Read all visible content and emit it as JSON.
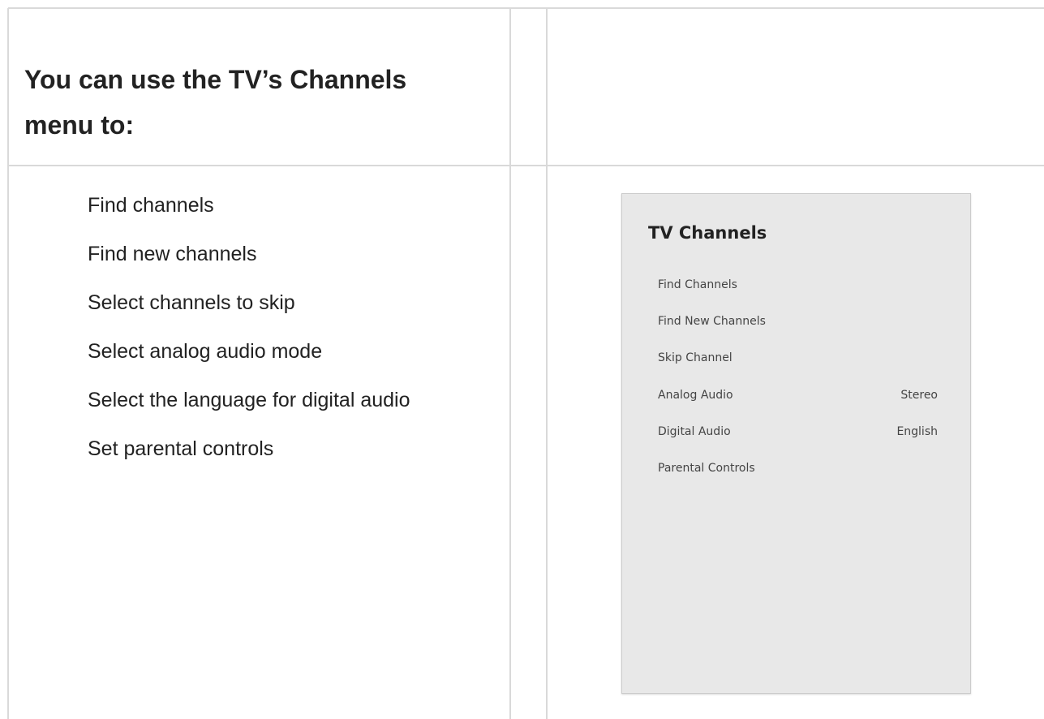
{
  "heading": "You can use the TV’s Channels menu to:",
  "features": [
    "Find channels",
    "Find new channels",
    "Select channels to skip",
    "Select analog audio mode",
    "Select the language for digital audio",
    "Set parental controls"
  ],
  "tv_menu": {
    "title": "TV Channels",
    "items": [
      {
        "label": "Find Channels",
        "value": ""
      },
      {
        "label": "Find New Channels",
        "value": ""
      },
      {
        "label": "Skip Channel",
        "value": ""
      },
      {
        "label": "Analog Audio",
        "value": "Stereo"
      },
      {
        "label": "Digital Audio",
        "value": "English"
      },
      {
        "label": "Parental Controls",
        "value": ""
      }
    ]
  }
}
